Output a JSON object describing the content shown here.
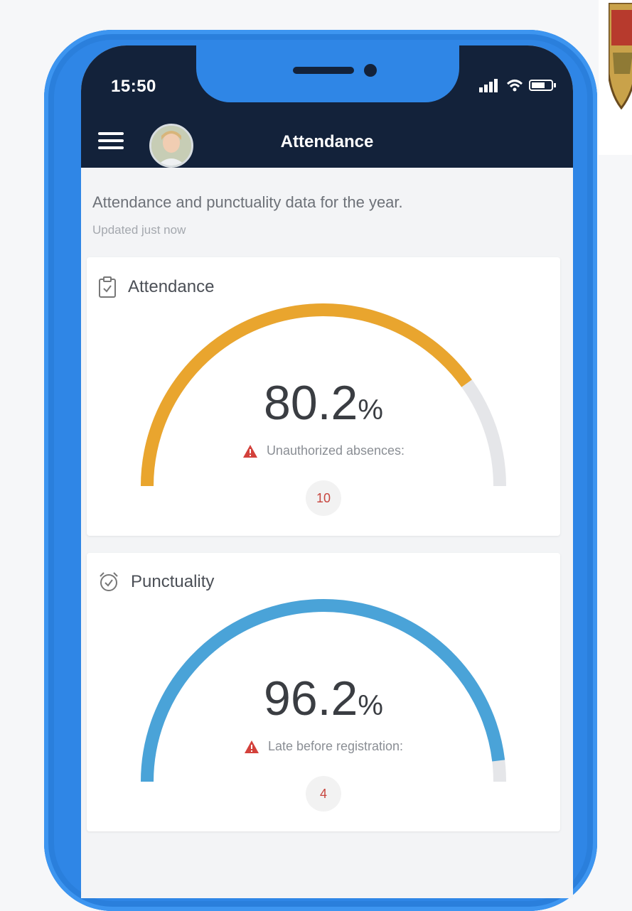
{
  "status_bar": {
    "time": "15:50"
  },
  "header": {
    "title": "Attendance"
  },
  "intro": {
    "description": "Attendance and punctuality data for the year.",
    "updated": "Updated just now"
  },
  "attendance": {
    "title": "Attendance",
    "value": "80.2",
    "unit": "%",
    "fraction": 0.802,
    "warning_label": "Unauthorized absences:",
    "count": "10",
    "color": "#e9a52e"
  },
  "punctuality": {
    "title": "Punctuality",
    "value": "96.2",
    "unit": "%",
    "fraction": 0.962,
    "warning_label": "Late before registration:",
    "count": "4",
    "color": "#4aa3d8"
  },
  "colors": {
    "navy": "#13223a",
    "phone_frame": "#2f86e6",
    "track": "#e5e6e9",
    "warning": "#d3413b"
  }
}
